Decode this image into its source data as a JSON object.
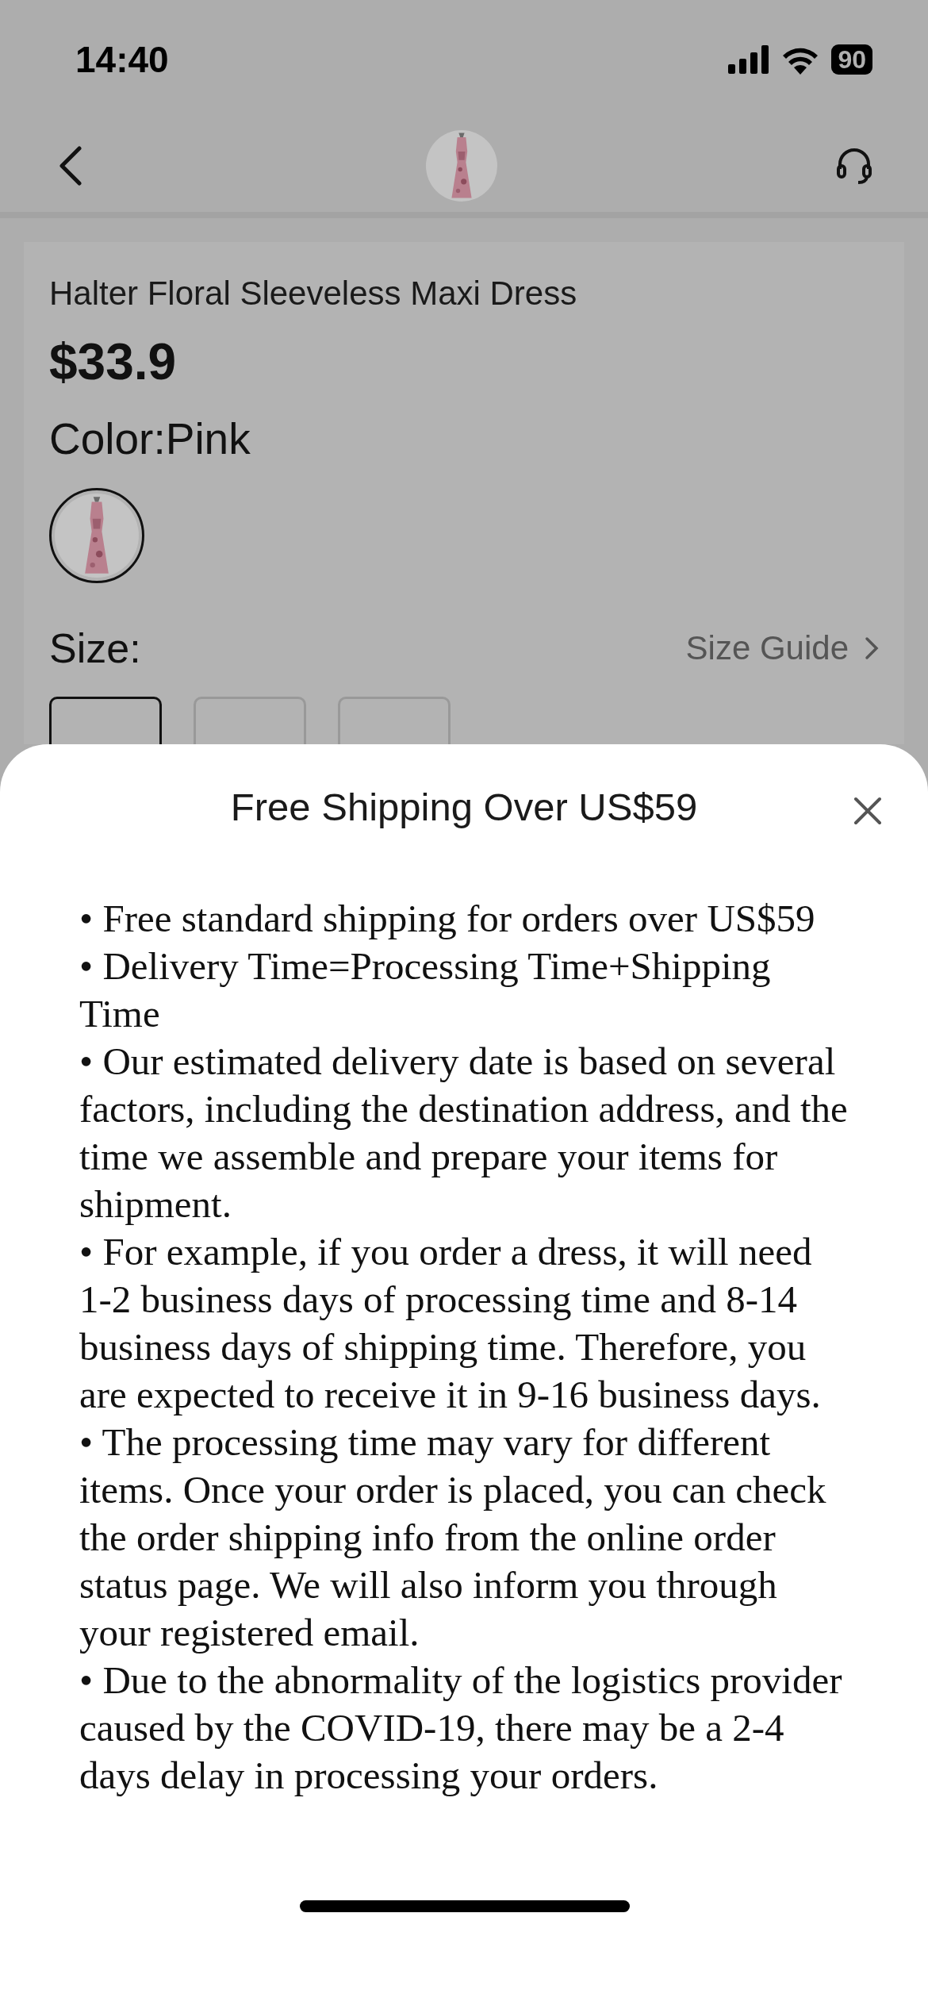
{
  "status_bar": {
    "time": "14:40",
    "battery": "90"
  },
  "product": {
    "title": "Halter Floral Sleeveless Maxi Dress",
    "price": "$33.9",
    "color_label": "Color:Pink",
    "swatches": [
      {
        "kind": "picture",
        "selected": true
      }
    ],
    "size_label": "Size:",
    "size_guide": "Size Guide",
    "sizes": [
      {
        "selected": true
      },
      {
        "selected": false
      },
      {
        "selected": false
      }
    ]
  },
  "sheet": {
    "title": "Free Shipping Over US$59",
    "items": [
      "•  Free standard shipping for orders over US$59",
      "•  Delivery Time=Processing Time+Shipping Time",
      "•  Our estimated delivery date is based on several factors, including the destination address, and the time we assemble and prepare your items for shipment.",
      "•  For example, if you order a dress, it will need 1-2 business days of processing time and 8-14 business days of shipping time. Therefore, you are expected to receive it in 9-16 business days.",
      "•  The processing time may vary for different items. Once your order is placed, you can check the order shipping info from the online order status page. We will also inform you through your registered email.",
      "•  Due to the abnormality of the logistics provider caused by the COVID-19, there may be a 2-4 days delay in processing your orders."
    ]
  }
}
